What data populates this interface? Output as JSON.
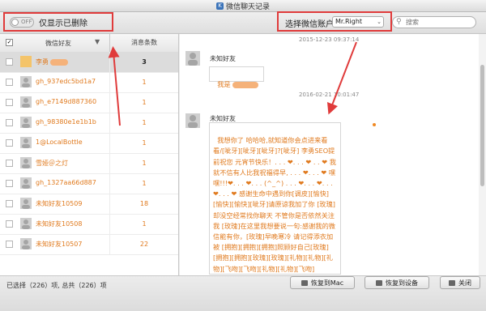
{
  "app": {
    "title": "微信聊天记录",
    "icon_letter": "K"
  },
  "toolbar": {
    "toggle_label": "OFF",
    "only_deleted_label": "仅显示已删除",
    "account_label": "选择微信账户",
    "account_value": "Mr.Right",
    "search_placeholder": "搜索"
  },
  "list": {
    "header_friend": "微信好友",
    "header_count": "消息条数",
    "rows": [
      {
        "name": "李勇",
        "count": "3"
      },
      {
        "name": "gh_937edc5bd1a7",
        "count": "1"
      },
      {
        "name": "gh_e7149d887360",
        "count": "1"
      },
      {
        "name": "gh_98380e1e1b1b",
        "count": "1"
      },
      {
        "name": "1@LocalBottle",
        "count": "1"
      },
      {
        "name": "雪娅＠之灯",
        "count": "1"
      },
      {
        "name": "gh_1327aa66d887",
        "count": "1"
      },
      {
        "name": "未知好友10509",
        "count": "18"
      },
      {
        "name": "未知好友10508",
        "count": "1"
      },
      {
        "name": "未知好友10507",
        "count": "22"
      }
    ]
  },
  "chat": {
    "ts1": "2015-12-23 09:37:14",
    "sender1": "未知好友",
    "msg1": "我是",
    "ts2": "2016-02-21 10:01:47",
    "sender2": "未知好友",
    "msg2": "我想你了 哈哈哈,就知道你会点进来看看/[呲牙][呲牙][呲牙]?[呲牙] 李勇SEO提前祝您 元宵节快乐！. . . ❤. . . ❤ . . ❤ 我就不信有人比我祝福得早, . . . ❤. . . ❤ 嘿嘿!!!❤. . . ❤. . . (^_^) . . . ❤. . . ❤. . . ❤. . . ❤ 感谢生命中遇到你[调皮][愉快][愉快][愉快][呲牙]请原谅我加了你 [玫瑰]却没空经常找你聊天 不管你是否依然关注我 [玫瑰]在这里我想要说一句:感谢我的微信能有你，[玫瑰]早晚寒冷 请记得添衣加被 [拥抱][拥抱][拥抱]照顾好自己[玫瑰][拥抱][拥抱][玫瑰][玫瑰][礼物][礼物][礼物][飞吻][飞吻][礼物][礼物][飞吻]"
  },
  "footer": {
    "status": "已选择（226）项, 总共（226）项",
    "restore_mac": "恢复到Mac",
    "restore_device": "恢复到设备",
    "close": "关闭"
  },
  "colors": {
    "accent": "#e07a1e",
    "annotation_red": "#e03b3b"
  }
}
